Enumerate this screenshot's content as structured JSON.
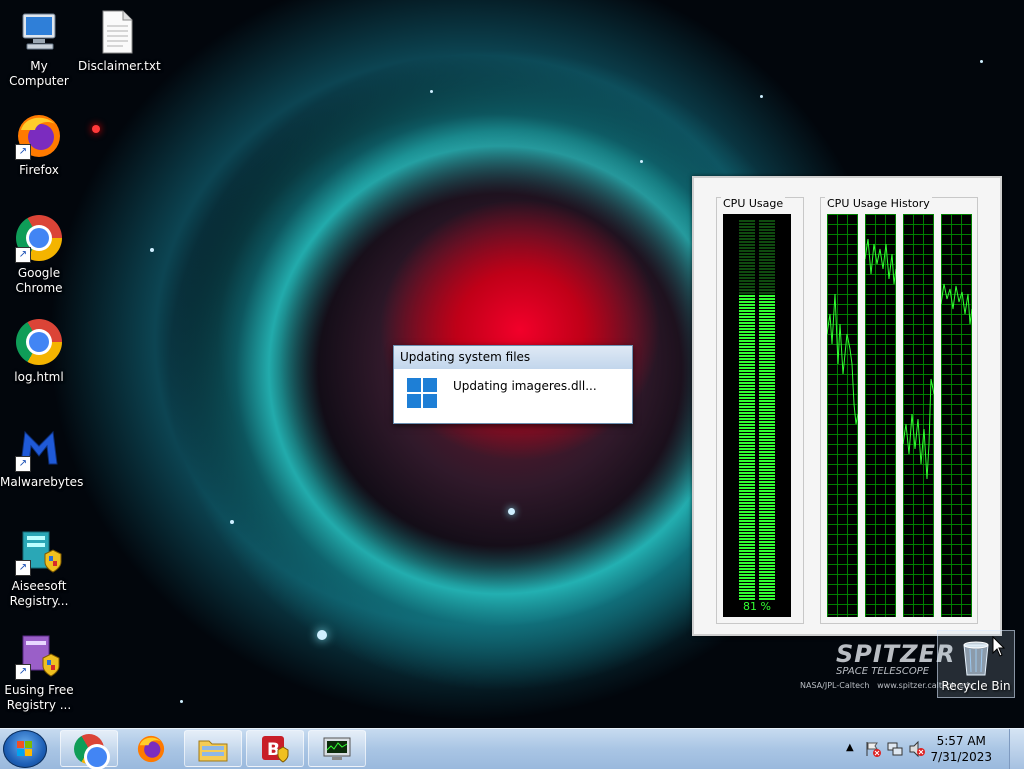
{
  "desktop": {
    "icons": [
      {
        "label": "My Computer",
        "icon": "computer-icon"
      },
      {
        "label": "Disclaimer.txt",
        "icon": "text-file-icon"
      },
      {
        "label": "Firefox",
        "icon": "firefox-icon"
      },
      {
        "label": "Google Chrome",
        "icon": "chrome-icon"
      },
      {
        "label": "log.html",
        "icon": "chrome-icon"
      },
      {
        "label": "Malwarebytes",
        "icon": "malwarebytes-icon"
      },
      {
        "label": "Aiseesoft Registry...",
        "icon": "aiseesoft-icon"
      },
      {
        "label": "Eusing Free Registry ...",
        "icon": "eusing-icon"
      }
    ],
    "recycle_bin": {
      "label": "Recycle Bin",
      "icon": "recycle-bin-icon"
    },
    "watermark": {
      "brand": "SPITZER",
      "subtitle": "SPACE TELESCOPE",
      "credit": "NASA/JPL-Caltech   www.spitzer.caltech.edu"
    }
  },
  "dialog": {
    "title": "Updating system files",
    "message": "Updating imageres.dll...",
    "icon": "windows-logo-icon"
  },
  "cpu_gadget": {
    "usage_label": "CPU Usage",
    "history_label": "CPU Usage History",
    "usage_percent": 81,
    "usage_text": "81 %",
    "meter_color": "#32ff32"
  },
  "taskbar": {
    "start_icon": "windows-start-icon",
    "buttons": [
      {
        "icon": "chrome-icon",
        "active": true
      },
      {
        "icon": "firefox-icon",
        "active": false
      },
      {
        "icon": "folder-icon",
        "active": true
      },
      {
        "icon": "b-app-icon",
        "active": true
      },
      {
        "icon": "monitor-app-icon",
        "active": true
      }
    ],
    "tray": {
      "icons": [
        "show-hidden-icons-arrow",
        "action-center-flag-icon",
        "network-icon",
        "volume-muted-icon"
      ],
      "time": "5:57 AM",
      "date": "7/31/2023"
    }
  },
  "colors": {
    "taskbar": "#a9c5e4",
    "accent": "#1e7fd6",
    "meter": "#32ff32"
  }
}
